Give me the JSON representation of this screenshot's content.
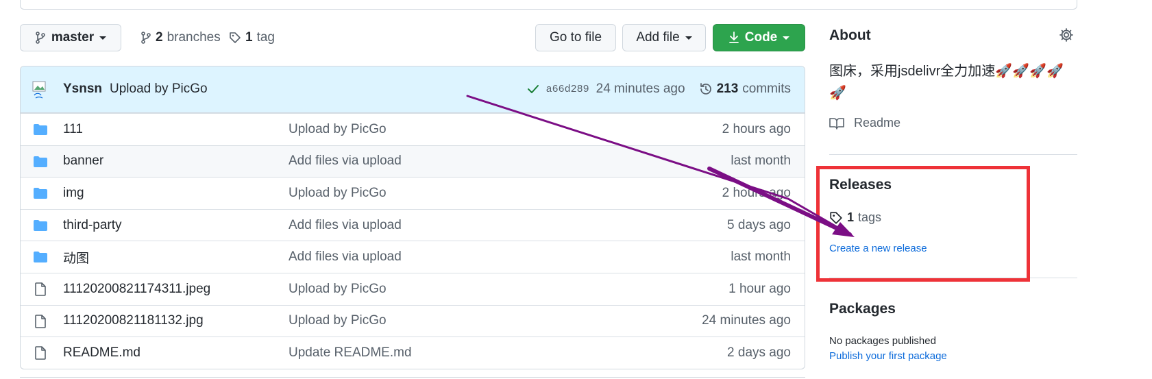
{
  "repo_header": {
    "branch": "master",
    "branches_count": "2",
    "branches_label": "branches",
    "tags_count": "1",
    "tags_label": "tag",
    "goto_file": "Go to file",
    "add_file": "Add file",
    "code": "Code"
  },
  "latest_commit": {
    "author": "Ysnsn",
    "message": "Upload by PicGo",
    "sha": "a66d289",
    "time": "24 minutes ago",
    "commits_count": "213",
    "commits_label": "commits"
  },
  "files": [
    {
      "type": "folder",
      "name": "111",
      "message": "Upload by PicGo",
      "age": "2 hours ago"
    },
    {
      "type": "folder",
      "name": "banner",
      "message": "Add files via upload",
      "age": "last month"
    },
    {
      "type": "folder",
      "name": "img",
      "message": "Upload by PicGo",
      "age": "2 hours ago"
    },
    {
      "type": "folder",
      "name": "third-party",
      "message": "Add files via upload",
      "age": "5 days ago"
    },
    {
      "type": "folder",
      "name": "动图",
      "message": "Add files via upload",
      "age": "last month"
    },
    {
      "type": "file",
      "name": "11120200821174311.jpeg",
      "message": "Upload by PicGo",
      "age": "1 hour ago"
    },
    {
      "type": "file",
      "name": "11120200821181132.jpg",
      "message": "Upload by PicGo",
      "age": "24 minutes ago"
    },
    {
      "type": "file",
      "name": "README.md",
      "message": "Update README.md",
      "age": "2 days ago"
    }
  ],
  "about": {
    "title": "About",
    "description": "图床，采用jsdelivr全力加速🚀🚀🚀🚀🚀",
    "readme": "Readme"
  },
  "releases": {
    "title": "Releases",
    "tags_count": "1",
    "tags_label": "tags",
    "create_link": "Create a new release"
  },
  "packages": {
    "title": "Packages",
    "none_text": "No packages published",
    "publish_link": "Publish your first package"
  },
  "colors": {
    "annotation_arrow": "#7b0e85",
    "highlight_box": "#ee3238",
    "code_button": "#2da44e",
    "folder_icon": "#54aeff",
    "link": "#0969da"
  }
}
